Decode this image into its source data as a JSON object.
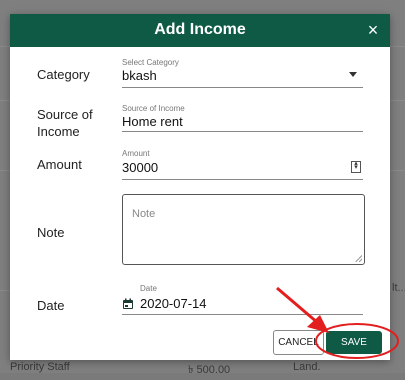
{
  "dialog": {
    "title": "Add Income",
    "close_glyph": "×",
    "fields": {
      "category": {
        "label": "Category",
        "small": "Select Category",
        "value": "bkash"
      },
      "source": {
        "label": "Source of Income",
        "small": "Source of Income",
        "value": "Home rent"
      },
      "amount": {
        "label": "Amount",
        "small": "Amount",
        "value": "30000"
      },
      "note": {
        "label": "Note",
        "placeholder": "Note",
        "value": ""
      },
      "date": {
        "label": "Date",
        "small": "Date",
        "value": "2020-07-14"
      }
    },
    "buttons": {
      "cancel": "CANCEL",
      "save": "SAVE"
    }
  },
  "background": {
    "row_label": "Priority Staff",
    "row_amount": "৳ 500.00",
    "row_category": "Land.",
    "right_fragment": "lt..."
  },
  "colors": {
    "header": "#0f5a45",
    "annotation": "#e31e1e"
  },
  "icons": [
    "close-icon",
    "dropdown-caret-icon",
    "number-stepper-icon",
    "calendar-icon",
    "annotation-arrow-icon"
  ]
}
